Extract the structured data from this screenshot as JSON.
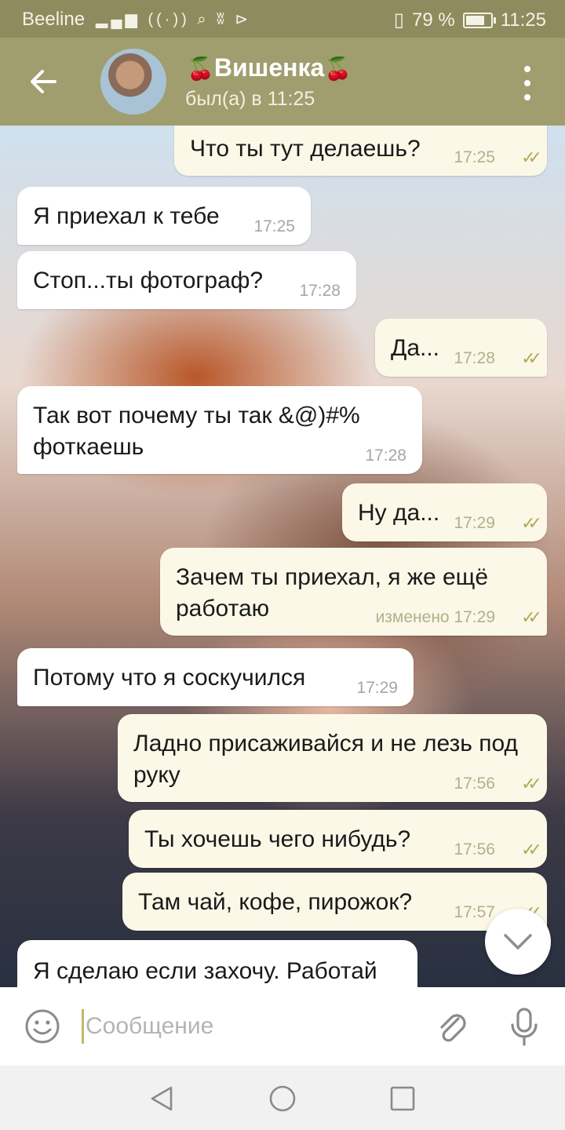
{
  "status": {
    "carrier": "Beeline",
    "battery_text": "79 %",
    "battery_level": 0.79,
    "time": "11:25"
  },
  "header": {
    "title": "Вишенка",
    "title_emoji": "🍒",
    "subtitle": "был(а) в 11:25"
  },
  "messages": [
    {
      "dir": "out",
      "text": "Что ты тут делаешь?",
      "time": "17:25",
      "read": true
    },
    {
      "dir": "in",
      "text": "Я приехал к тебе",
      "time": "17:25"
    },
    {
      "dir": "in",
      "text": "Стоп...ты фотограф?",
      "time": "17:28"
    },
    {
      "dir": "out",
      "text": "Да...",
      "time": "17:28",
      "read": true
    },
    {
      "dir": "in",
      "text": "Так вот почему ты так &@)#% фоткаешь",
      "time": "17:28"
    },
    {
      "dir": "out",
      "text": "Ну да...",
      "time": "17:29",
      "read": true
    },
    {
      "dir": "out",
      "text": "Зачем ты приехал, я же ещё работаю",
      "time": "изменено 17:29",
      "read": true
    },
    {
      "dir": "in",
      "text": "Потому что я соскучился",
      "time": "17:29"
    },
    {
      "dir": "out",
      "text": "Ладно присаживайся и не лезь под руку",
      "time": "17:56",
      "read": true
    },
    {
      "dir": "out",
      "text": "Ты хочешь чего нибудь?",
      "time": "17:56",
      "read": true
    },
    {
      "dir": "out",
      "text": "Там чай, кофе, пирожок?",
      "time": "17:57",
      "read": true
    },
    {
      "dir": "in",
      "text": "Я сделаю если захочу. Работай",
      "time": ""
    }
  ],
  "input": {
    "placeholder": "Сообщение"
  },
  "icons": {
    "back": "arrow-left-icon",
    "menu": "more-vertical-icon",
    "emoji": "smile-icon",
    "attach": "paperclip-icon",
    "mic": "microphone-icon",
    "scroll": "chevron-down-icon"
  },
  "colors": {
    "header_bg": "#a09e6e",
    "status_bg": "#8e8c5e",
    "outgoing_bubble": "#fbf8e8",
    "incoming_bubble": "#ffffff",
    "read_check": "#b4a85c"
  }
}
